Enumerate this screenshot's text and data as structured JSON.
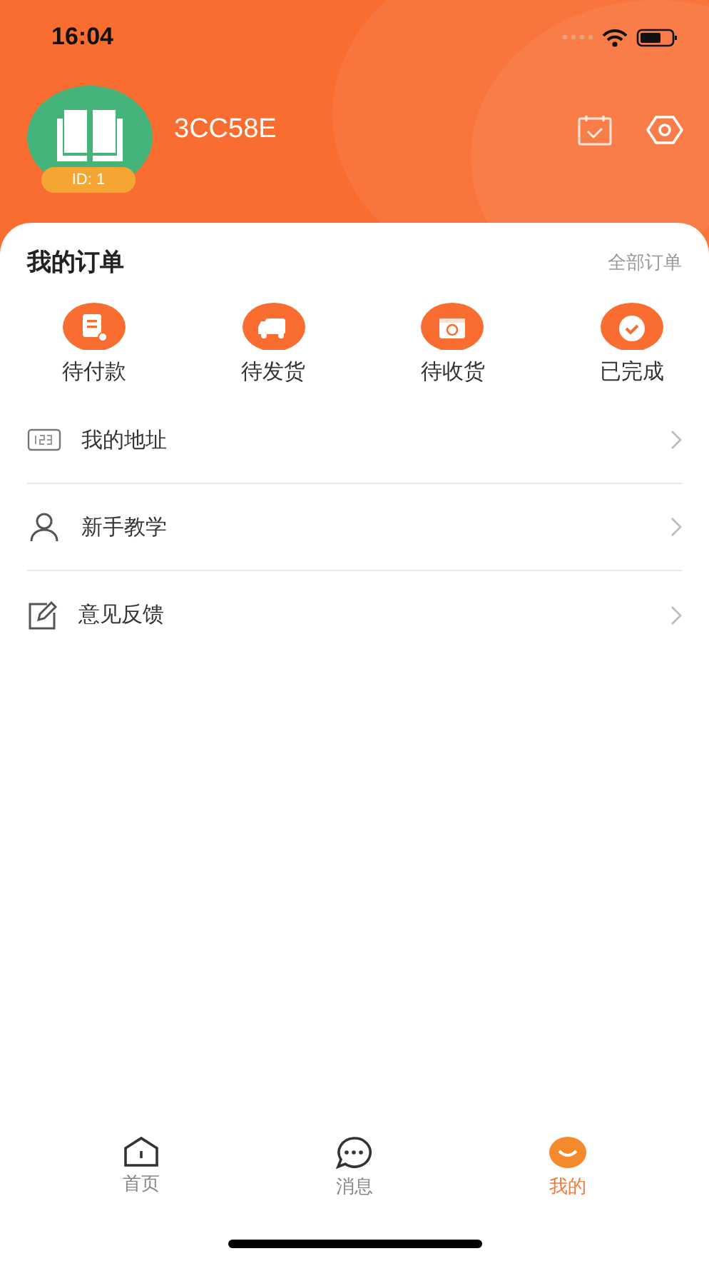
{
  "status_bar": {
    "time": "16:04"
  },
  "profile": {
    "name": "3CC58E",
    "id_badge": "ID: 1"
  },
  "orders": {
    "title": "我的订单",
    "all_link": "全部订单",
    "items": [
      {
        "label": "待付款"
      },
      {
        "label": "待发货"
      },
      {
        "label": "待收货"
      },
      {
        "label": "已完成"
      }
    ]
  },
  "menu": [
    {
      "label": "我的地址"
    },
    {
      "label": "新手教学"
    },
    {
      "label": "意见反馈"
    }
  ],
  "tab_bar": [
    {
      "label": "首页",
      "selected": false
    },
    {
      "label": "消息",
      "selected": false
    },
    {
      "label": "我的",
      "selected": true
    }
  ]
}
